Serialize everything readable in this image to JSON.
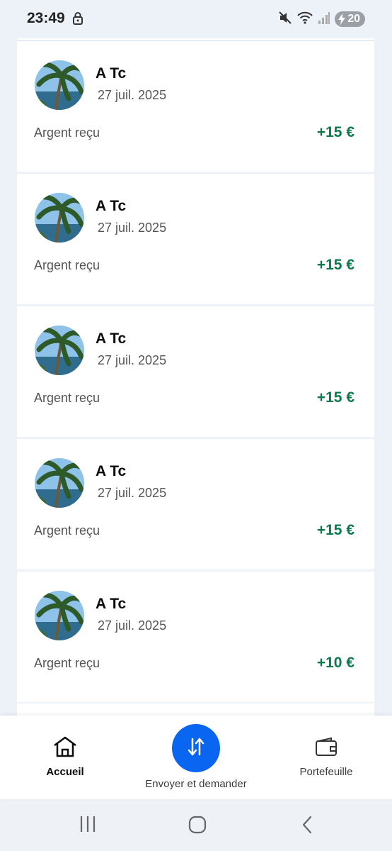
{
  "status_bar": {
    "time": "23:49",
    "battery": "20"
  },
  "transactions": [
    {
      "name": "A Tc",
      "date": "27 juil. 2025",
      "kind": "Argent reçu",
      "amount": "+15 €"
    },
    {
      "name": "A Tc",
      "date": "27 juil. 2025",
      "kind": "Argent reçu",
      "amount": "+15 €"
    },
    {
      "name": "A Tc",
      "date": "27 juil. 2025",
      "kind": "Argent reçu",
      "amount": "+15 €"
    },
    {
      "name": "A Tc",
      "date": "27 juil. 2025",
      "kind": "Argent reçu",
      "amount": "+15 €"
    },
    {
      "name": "A Tc",
      "date": "27 juil. 2025",
      "kind": "Argent reçu",
      "amount": "+10 €"
    }
  ],
  "bottom_nav": {
    "home_label": "Accueil",
    "send_label": "Envoyer et demander",
    "wallet_label": "Portefeuille"
  },
  "colors": {
    "accent": "#0a66f0",
    "positive": "#0b7a4b",
    "background": "#edf1f8"
  },
  "icons": [
    "lock-icon",
    "mute-icon",
    "wifi-icon",
    "signal-icon",
    "battery-icon",
    "home-icon",
    "send-request-icon",
    "wallet-icon",
    "recents-icon",
    "home-nav-icon",
    "back-icon"
  ]
}
